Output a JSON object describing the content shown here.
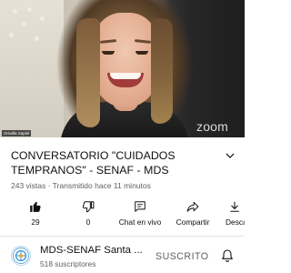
{
  "player": {
    "participant_name": "Ornella Sapiel",
    "watermark": "zoom"
  },
  "video": {
    "title": "CONVERSATORIO \"CUIDADOS TEMPRANOS\" - SENAF - MDS",
    "meta": "243 vistas · Transmitido hace 11 minutos"
  },
  "actions": {
    "like_count": "29",
    "dislike_count": "0",
    "chat_label": "Chat en vivo",
    "share_label": "Compartir",
    "download_label": "Descargar"
  },
  "channel": {
    "name": "MDS-SENAF Santa ...",
    "subscribers": "518 suscriptores",
    "subscribe_label": "SUSCRITO"
  },
  "icons": {
    "expand": "chevron-down-icon",
    "like": "thumbs-up-icon",
    "dislike": "thumbs-down-icon",
    "chat": "chat-icon",
    "share": "share-icon",
    "download": "download-icon",
    "notifications": "bell-icon"
  }
}
